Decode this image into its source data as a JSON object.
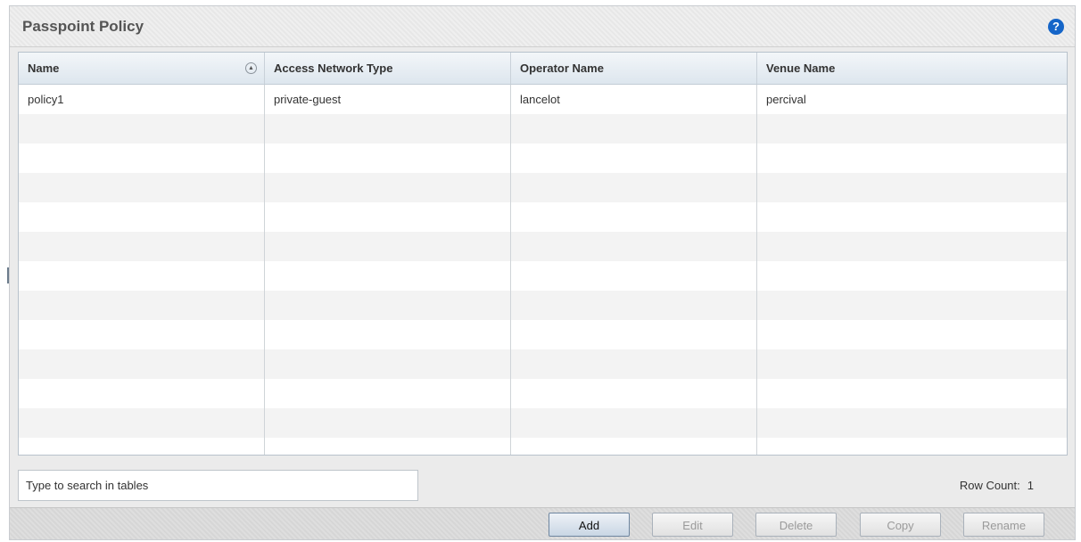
{
  "panel": {
    "title": "Passpoint Policy",
    "help_icon": "question-circle-icon"
  },
  "table": {
    "columns": [
      "Name",
      "Access Network Type",
      "Operator Name",
      "Venue Name"
    ],
    "sort_icon": "sort-ascending-icon",
    "rows": [
      {
        "name": "policy1",
        "access_network_type": "private-guest",
        "operator_name": "lancelot",
        "venue_name": "percival"
      }
    ]
  },
  "search": {
    "placeholder": "Type to search in tables",
    "value": ""
  },
  "row_count": {
    "label": "Row Count:",
    "value": "1"
  },
  "buttons": {
    "add": "Add",
    "edit": "Edit",
    "delete": "Delete",
    "copy": "Copy",
    "rename": "Rename"
  },
  "colors": {
    "help_icon": "#1565c8",
    "header_gradient_top": "#f3f6f9",
    "header_gradient_bottom": "#dde6ee"
  }
}
